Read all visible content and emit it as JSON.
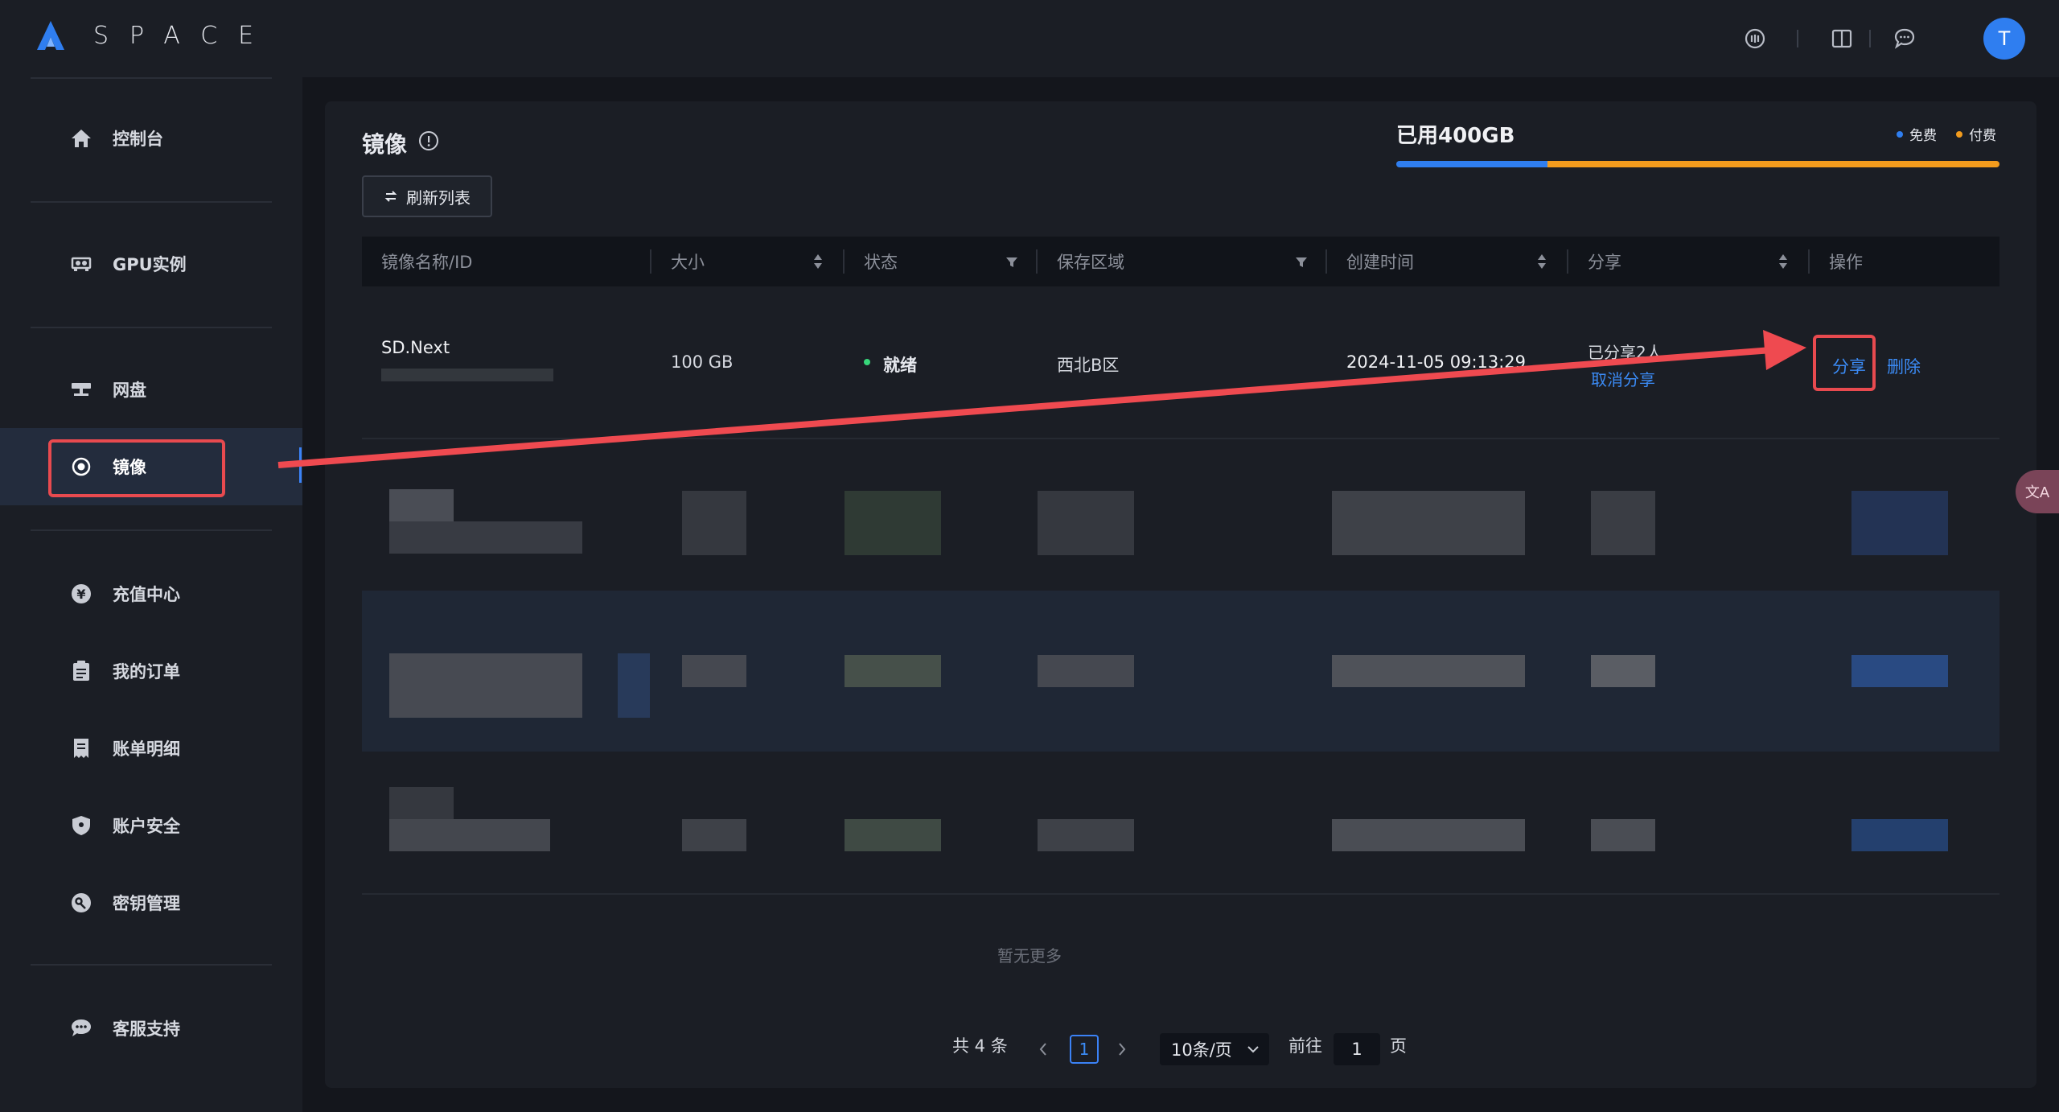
{
  "app": {
    "logo_text": "SPACE"
  },
  "sidebar": {
    "items": [
      {
        "label": "控制台",
        "icon": "home-icon"
      },
      {
        "label": "GPU实例",
        "icon": "gpu-icon"
      },
      {
        "label": "网盘",
        "icon": "disk-icon"
      },
      {
        "label": "镜像",
        "icon": "image-icon",
        "active": true
      },
      {
        "label": "充值中心",
        "icon": "yen-icon"
      },
      {
        "label": "我的订单",
        "icon": "order-icon"
      },
      {
        "label": "账单明细",
        "icon": "bill-icon"
      },
      {
        "label": "账户安全",
        "icon": "shield-icon"
      },
      {
        "label": "密钥管理",
        "icon": "key-icon"
      },
      {
        "label": "客服支持",
        "icon": "chat-icon"
      }
    ]
  },
  "header": {
    "avatar_letter": "T",
    "icons": [
      "settings-circle-icon",
      "book-icon",
      "message-icon"
    ]
  },
  "page": {
    "title": "镜像",
    "refresh_label": "刷新列表"
  },
  "storage": {
    "title": "已用400GB",
    "legend_free": "免费",
    "legend_paid": "付费",
    "free_fraction": 0.25,
    "colors": {
      "free": "#2f7ef0",
      "paid": "#f29b1d"
    }
  },
  "table": {
    "columns": [
      "镜像名称/ID",
      "大小",
      "状态",
      "保存区域",
      "创建时间",
      "分享",
      "操作"
    ],
    "rows": [
      {
        "name": "SD.Next",
        "size": "100 GB",
        "status": "就绪",
        "region": "西北B区",
        "created": "2024-11-05 09:13:29",
        "share_info": "已分享2人",
        "cancel_share": "取消分享",
        "action_share": "分享",
        "action_delete": "删除"
      }
    ],
    "no_more": "暂无更多"
  },
  "pagination": {
    "total": "共 4 条",
    "current_page": "1",
    "page_size": "10条/页",
    "goto_label": "前往",
    "goto_value": "1",
    "page_suffix": "页"
  },
  "translate_tab": "文A"
}
